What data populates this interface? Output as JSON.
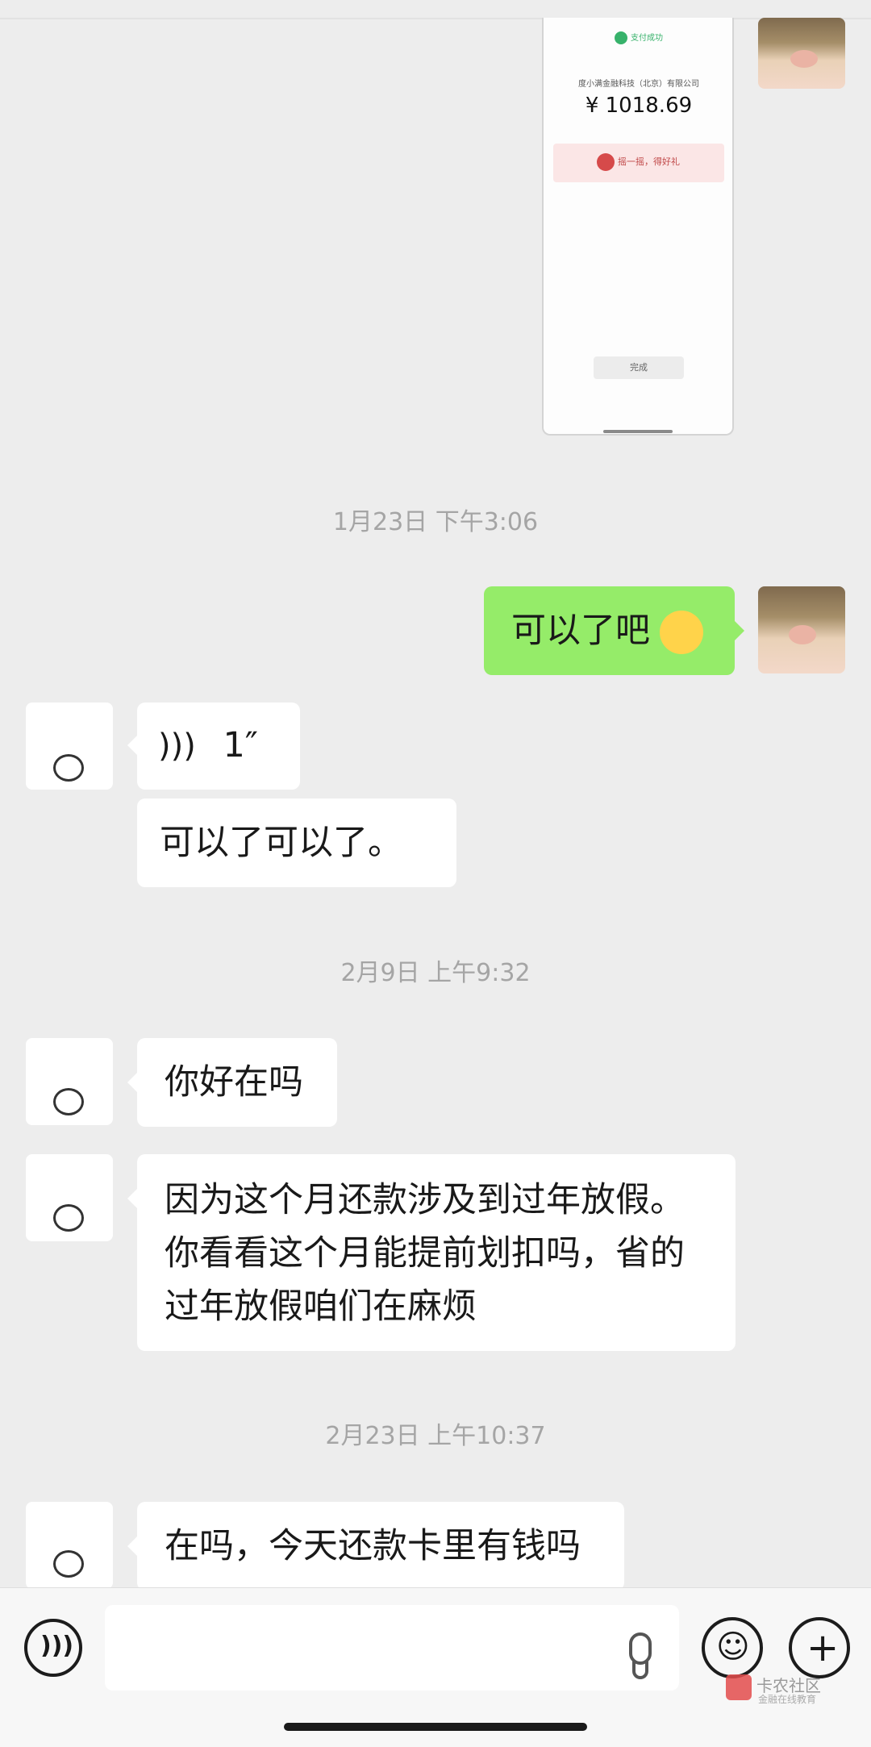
{
  "shared_receipt": {
    "status": "支付成功",
    "merchant": "度小满金融科技（北京）有限公司",
    "amount": "¥ 1018.69",
    "promo": "摇一摇，得好礼",
    "button": "完成"
  },
  "timestamps": [
    "1月23日 下午3:06",
    "2月9日 上午9:32",
    "2月23日 上午10:37"
  ],
  "messages": {
    "m1": "可以了吧",
    "voice_duration": "1″",
    "m2": "可以了可以了。",
    "m3": "你好在吗",
    "m4": "因为这个月还款涉及到过年放假。你看看这个月能提前划扣吗，省的过年放假咱们在麻烦",
    "m5": "在吗，今天还款卡里有钱吗"
  },
  "input": {
    "value": ""
  },
  "watermark": {
    "name": "卡农社区",
    "sub": "金融在线教育"
  },
  "colors": {
    "background": "#ededed",
    "sent_bubble": "#95ec69",
    "received_bubble": "#ffffff",
    "timestamp": "#a5a5a5"
  }
}
